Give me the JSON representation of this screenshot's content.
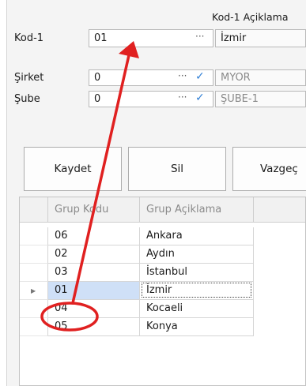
{
  "header": {
    "kod1_aciklama_label": "Kod-1 Açiklama"
  },
  "form": {
    "kod1": {
      "label": "Kod-1",
      "value": "01",
      "lookup": "···",
      "desc": "İzmir"
    },
    "sirket": {
      "label": "Şirket",
      "value": "0",
      "lookup": "···",
      "check": "✓",
      "desc": "MYOR"
    },
    "sube": {
      "label": "Şube",
      "value": "0",
      "lookup": "···",
      "check": "✓",
      "desc": "ŞUBE-1"
    }
  },
  "buttons": {
    "kaydet": "Kaydet",
    "sil": "Sil",
    "vazgec": "Vazgeç"
  },
  "grid": {
    "columns": [
      "Grup Kodu",
      "Grup Açiklama"
    ],
    "current_row_marker": "▶",
    "rows": [
      {
        "code": "06",
        "desc": "Ankara"
      },
      {
        "code": "02",
        "desc": "Aydın"
      },
      {
        "code": "03",
        "desc": "İstanbul"
      },
      {
        "code": "01",
        "desc": "İzmir"
      },
      {
        "code": "04",
        "desc": "Kocaeli"
      },
      {
        "code": "05",
        "desc": "Konya"
      }
    ],
    "selected_index": 3
  },
  "annotation": {
    "color": "#e02020",
    "highlight_row": "01"
  }
}
